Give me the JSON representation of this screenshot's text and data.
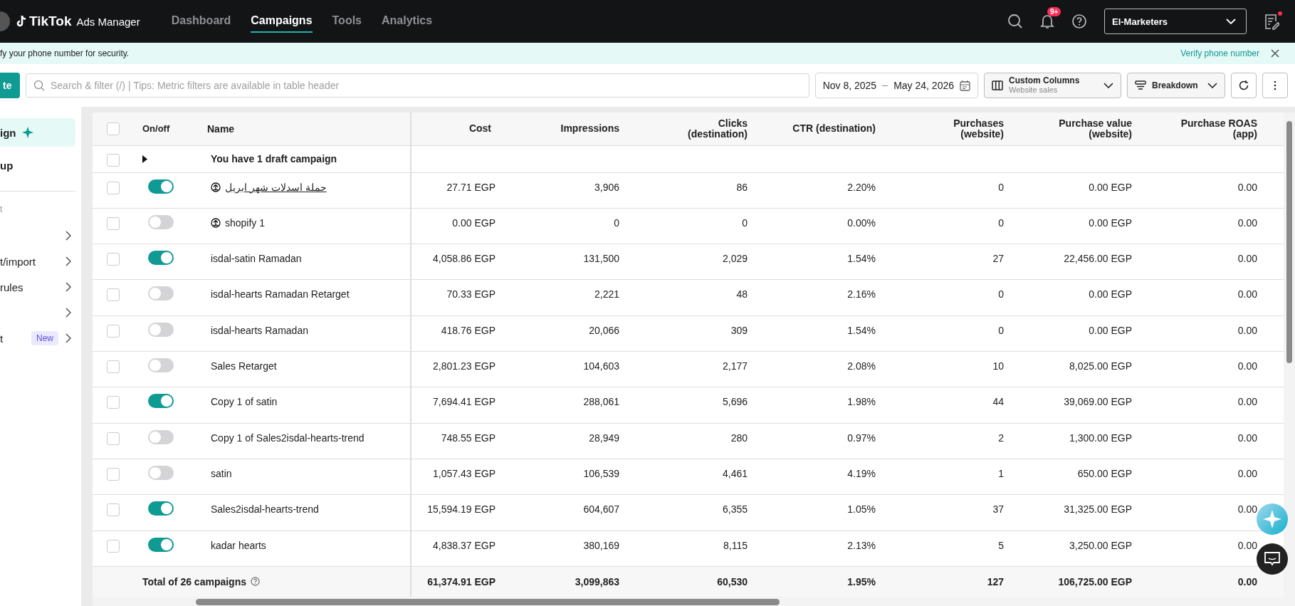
{
  "topbar": {
    "logo": "TikTok",
    "product": "Ads Manager",
    "nav": [
      {
        "label": "Dashboard",
        "selected": false
      },
      {
        "label": "Campaigns",
        "selected": true
      },
      {
        "label": "Tools",
        "selected": false
      },
      {
        "label": "Analytics",
        "selected": false
      }
    ],
    "notification_badge": "9+",
    "account": "El-Marketers"
  },
  "notice": {
    "text": "fy your phone number for security.",
    "action": "Verify phone number"
  },
  "toolbar": {
    "create_button": "te",
    "search": {
      "placeholder": "Search & filter (/) | Tips: Metric filters are available in table header"
    },
    "date_start": "Nov 8, 2025",
    "date_end": "May 24, 2026",
    "columns_title": "Custom Columns",
    "columns_sub": "Website sales",
    "breakdown": "Breakdown"
  },
  "sidebar": {
    "items": [
      {
        "label": "ign",
        "selected": true
      },
      {
        "label": "up",
        "selected": false
      }
    ],
    "section": "t",
    "tools": [
      {
        "kind": "arrow"
      },
      {
        "kind": "link",
        "label": "t/import"
      },
      {
        "kind": "link",
        "label": "rules"
      },
      {
        "kind": "arrow"
      },
      {
        "kind": "link",
        "label": "t",
        "badge": "New"
      }
    ]
  },
  "table": {
    "select_all_checked": false,
    "toggle_column": "On/off",
    "columns": [
      "Name",
      "Cost",
      "Impressions",
      "Clicks\n(destination)",
      "CTR (destination)",
      "Purchases\n(website)",
      "Purchase value\n(website)",
      "Purchase ROAS\n(app)"
    ],
    "draft_row": "You have 1 draft campaign",
    "draft_checked": false,
    "rows": [
      {
        "checked": false,
        "on": true,
        "icon": true,
        "hovered": true,
        "cells": [
          "حملة اسدلات شهر ابريل",
          "27.71 EGP",
          "3,906",
          "86",
          "2.20%",
          "0",
          "0.00 EGP",
          "0.00"
        ]
      },
      {
        "checked": false,
        "on": false,
        "icon": true,
        "hovered": false,
        "cells": [
          "shopify 1",
          "0.00 EGP",
          "0",
          "0",
          "0.00%",
          "0",
          "0.00 EGP",
          "0.00"
        ]
      },
      {
        "checked": false,
        "on": true,
        "icon": false,
        "hovered": false,
        "cells": [
          "isdal-satin Ramadan",
          "4,058.86 EGP",
          "131,500",
          "2,029",
          "1.54%",
          "27",
          "22,456.00 EGP",
          "0.00"
        ]
      },
      {
        "checked": false,
        "on": false,
        "icon": false,
        "hovered": false,
        "cells": [
          "isdal-hearts Ramadan Retarget",
          "70.33 EGP",
          "2,221",
          "48",
          "2.16%",
          "0",
          "0.00 EGP",
          "0.00"
        ]
      },
      {
        "checked": false,
        "on": false,
        "icon": false,
        "hovered": false,
        "cells": [
          "isdal-hearts Ramadan",
          "418.76 EGP",
          "20,066",
          "309",
          "1.54%",
          "0",
          "0.00 EGP",
          "0.00"
        ]
      },
      {
        "checked": false,
        "on": false,
        "icon": false,
        "hovered": false,
        "cells": [
          "Sales Retarget",
          "2,801.23 EGP",
          "104,603",
          "2,177",
          "2.08%",
          "10",
          "8,025.00 EGP",
          "0.00"
        ]
      },
      {
        "checked": false,
        "on": true,
        "icon": false,
        "hovered": false,
        "cells": [
          "Copy 1 of satin",
          "7,694.41 EGP",
          "288,061",
          "5,696",
          "1.98%",
          "44",
          "39,069.00 EGP",
          "0.00"
        ]
      },
      {
        "checked": false,
        "on": false,
        "icon": false,
        "hovered": false,
        "cells": [
          "Copy 1 of Sales2isdal-hearts-trend",
          "748.55 EGP",
          "28,949",
          "280",
          "0.97%",
          "2",
          "1,300.00 EGP",
          "0.00"
        ]
      },
      {
        "checked": false,
        "on": false,
        "icon": false,
        "hovered": false,
        "cells": [
          "satin",
          "1,057.43 EGP",
          "106,539",
          "4,461",
          "4.19%",
          "1",
          "650.00 EGP",
          "0.00"
        ]
      },
      {
        "checked": false,
        "on": true,
        "icon": false,
        "hovered": false,
        "cells": [
          "Sales2isdal-hearts-trend",
          "15,594.19 EGP",
          "604,607",
          "6,355",
          "1.05%",
          "37",
          "31,325.00 EGP",
          "0.00"
        ]
      },
      {
        "checked": false,
        "on": true,
        "icon": false,
        "hovered": false,
        "cells": [
          "kadar hearts",
          "4,838.37 EGP",
          "380,169",
          "8,115",
          "2.13%",
          "5",
          "3,250.00 EGP",
          "0.00"
        ]
      }
    ],
    "total": {
      "label": "Total of 26 campaigns",
      "cells": [
        "61,374.91 EGP",
        "3,099,863",
        "60,530",
        "1.95%",
        "127",
        "106,725.00 EGP",
        "0.00"
      ]
    }
  }
}
